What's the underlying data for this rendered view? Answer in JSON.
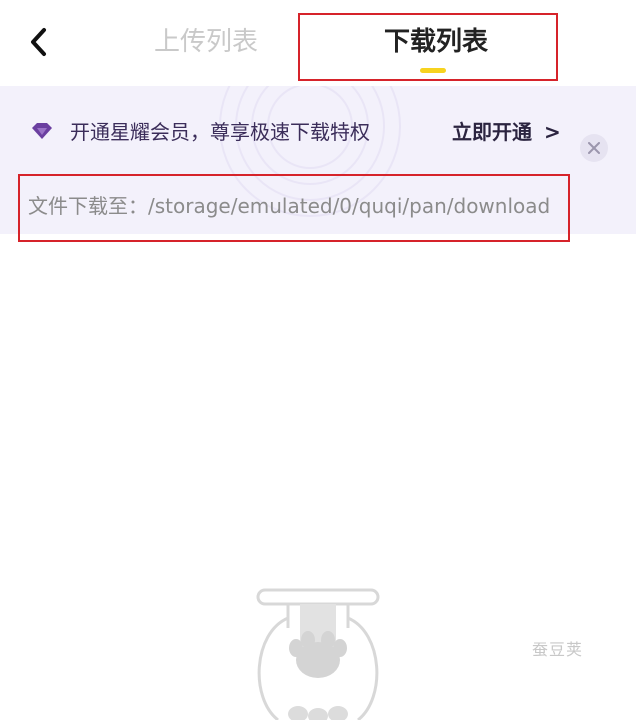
{
  "header": {
    "back_icon": "chevron-left-icon",
    "tabs": [
      {
        "label": "上传列表",
        "active": false
      },
      {
        "label": "下载列表",
        "active": true
      }
    ]
  },
  "vip_banner": {
    "icon": "diamond-icon",
    "text": "开通星耀会员，尊享极速下载特权",
    "action_label": "立即开通",
    "action_arrow": ">",
    "close_icon": "close-icon"
  },
  "download_path": {
    "text": "文件下载至：/storage/emulated/0/quqi/pan/download"
  },
  "empty_state": {
    "illustration": "cat-paw-jar-icon"
  },
  "watermark": "蚕豆荚",
  "colors": {
    "accent_underline": "#f7d31f",
    "vip_background": "#f3f1fb",
    "highlight_border": "#d6232a",
    "diamond": "#6b3fa0"
  }
}
